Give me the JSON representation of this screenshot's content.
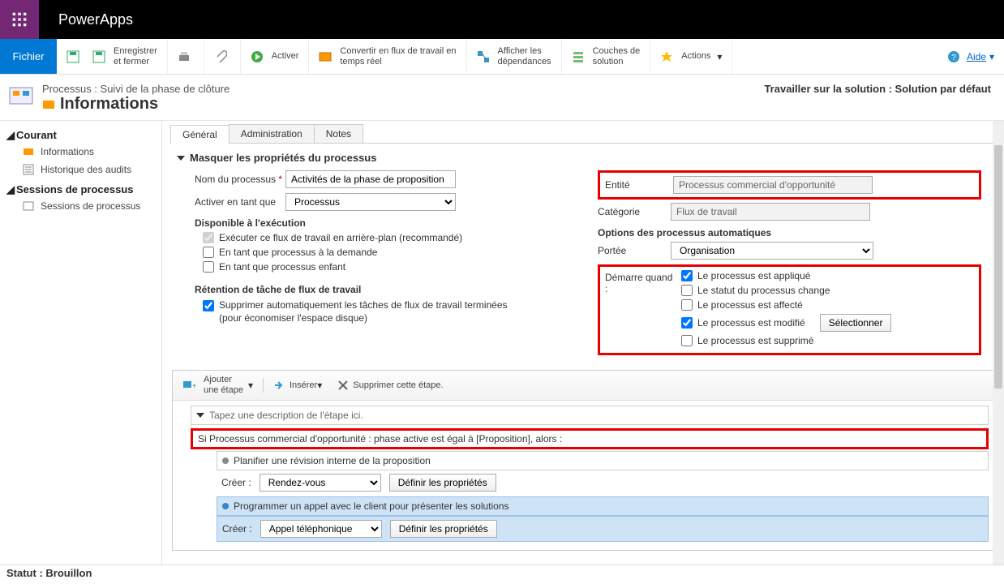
{
  "app": {
    "title": "PowerApps"
  },
  "ribbon": {
    "file": "Fichier",
    "save_close": "Enregistrer\net fermer",
    "activate": "Activer",
    "convert": "Convertir en flux de travail en\ntemps réel",
    "show_deps": "Afficher les\ndépendances",
    "solution_layers": "Couches de\nsolution",
    "actions": "Actions",
    "help": "Aide"
  },
  "header": {
    "breadcrumb": "Processus : Suivi de la phase de clôture",
    "title": "Informations",
    "solution": "Travailler sur la solution : Solution par défaut"
  },
  "sidebar": {
    "section_current": "Courant",
    "item_info": "Informations",
    "item_audit": "Historique des audits",
    "section_sessions": "Sessions de processus",
    "item_sessions": "Sessions de processus"
  },
  "tabs": {
    "general": "Général",
    "admin": "Administration",
    "notes": "Notes"
  },
  "sectionHdr": "Masquer les propriétés du processus",
  "form": {
    "name_lbl": "Nom du processus",
    "name_val": "Activités de la phase de proposition",
    "activate_lbl": "Activer en tant que",
    "activate_val": "Processus",
    "available_hdr": "Disponible à l'exécution",
    "bg_lbl": "Exécuter ce flux de travail en arrière-plan (recommandé)",
    "on_demand_lbl": "En tant que processus à la demande",
    "child_lbl": "En tant que processus enfant",
    "retention_hdr": "Rétention de tâche de flux de travail",
    "retention_lbl": "Supprimer automatiquement les tâches de flux de travail terminées (pour économiser l'espace disque)"
  },
  "right": {
    "entity_lbl": "Entité",
    "entity_val": "Processus commercial d'opportunité",
    "category_lbl": "Catégorie",
    "category_val": "Flux de travail",
    "auto_hdr": "Options des processus automatiques",
    "scope_lbl": "Portée",
    "scope_val": "Organisation",
    "start_lbl": "Démarre quand :",
    "start_applied": "Le processus est appliqué",
    "start_status": "Le statut du processus change",
    "start_assigned": "Le processus est affecté",
    "start_modified": "Le processus est modifié",
    "start_deleted": "Le processus est supprimé",
    "select_btn": "Sélectionner"
  },
  "wf": {
    "add_step": "Ajouter\nune étape",
    "insert": "Insérer",
    "delete_step": "Supprimer cette étape.",
    "desc_placeholder": "Tapez une description de l'étape ici.",
    "condition": "Si Processus commercial d'opportunité : phase active est égal à [Proposition], alors :",
    "action1_title": "Planifier une révision interne de la proposition",
    "create_lbl": "Créer :",
    "action1_type": "Rendez-vous",
    "set_props": "Définir les propriétés",
    "action2_title": "Programmer un appel avec le client pour présenter les solutions",
    "action2_type": "Appel téléphonique"
  },
  "status": "Statut : Brouillon"
}
